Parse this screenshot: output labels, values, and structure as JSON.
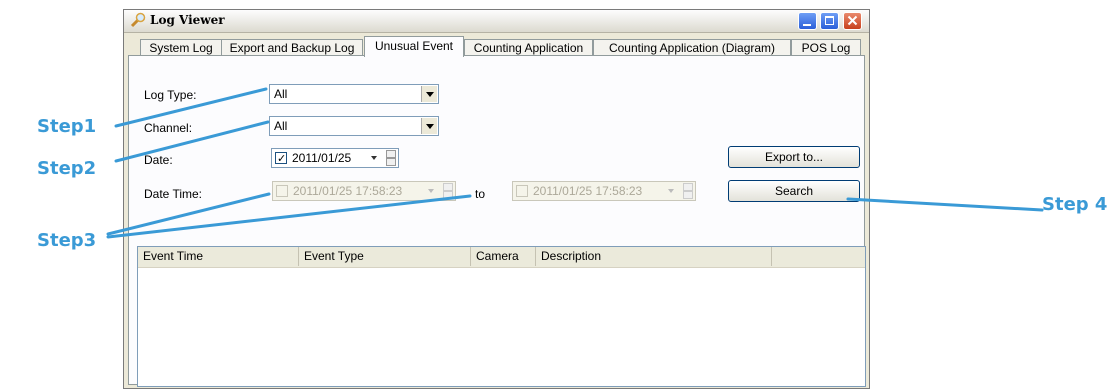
{
  "window": {
    "title": "Log Viewer"
  },
  "tabs": [
    {
      "label": "System Log",
      "active": false
    },
    {
      "label": "Export and Backup Log",
      "active": false
    },
    {
      "label": "Unusual Event",
      "active": true
    },
    {
      "label": "Counting Application",
      "active": false
    },
    {
      "label": "Counting Application (Diagram)",
      "active": false
    },
    {
      "label": "POS Log",
      "active": false
    }
  ],
  "form": {
    "log_type_label": "Log Type:",
    "log_type_value": "All",
    "channel_label": "Channel:",
    "channel_value": "All",
    "date_label": "Date:",
    "date_value": "2011/01/25",
    "date_checked": true,
    "datetime_label": "Date Time:",
    "datetime_from": "2011/01/25 17:58:23",
    "datetime_to": "2011/01/25 17:58:23",
    "to_label": "to",
    "export_button": "Export to...",
    "search_button": "Search"
  },
  "table": {
    "columns": [
      "Event Time",
      "Event Type",
      "Camera",
      "Description"
    ],
    "rows": []
  },
  "annotations": {
    "step1": "Step1",
    "step2": "Step2",
    "step3": "Step3",
    "step4": "Step 4"
  },
  "colors": {
    "annotation": "#3a9ad6",
    "tab_border": "#919b9c",
    "window_bg": "#ece9d8"
  }
}
